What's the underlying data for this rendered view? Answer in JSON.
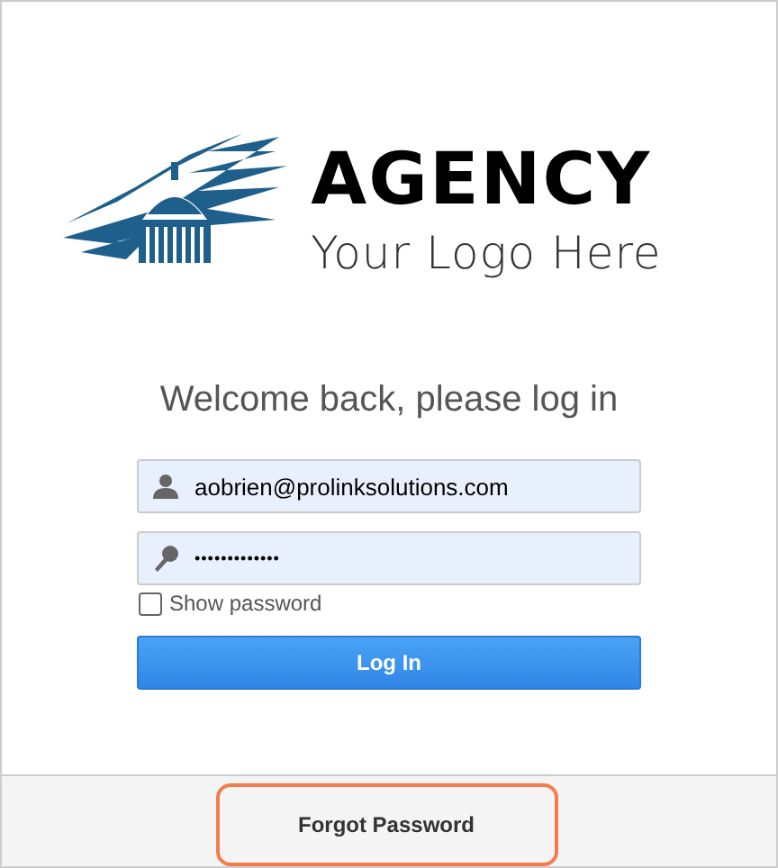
{
  "logo": {
    "name": "AGENCY",
    "tagline": "Your Logo Here"
  },
  "heading": "Welcome back, please log in",
  "email_field": {
    "value": "aobrien@prolinksolutions.com"
  },
  "password_field": {
    "value": "•••••••••••••"
  },
  "show_password": {
    "label": "Show password",
    "checked": false
  },
  "login_button": "Log In",
  "footer": {
    "link": "Forgot Password",
    "highlighted": true
  }
}
